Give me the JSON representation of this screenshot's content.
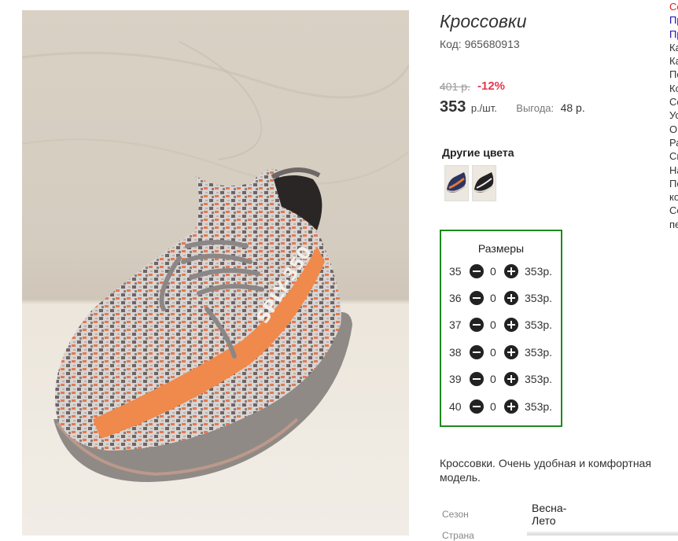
{
  "product": {
    "title": "Кроссовки",
    "sku": "Код: 965680913",
    "old_price": "401 р.",
    "discount": "-12%",
    "price": "353",
    "price_unit": "р./шт.",
    "saving_label": "Выгода:",
    "saving_value": "48 р."
  },
  "colors": {
    "title": "Другие цвета",
    "swatches": [
      "blue-orange-sneaker",
      "black-white-sneaker"
    ]
  },
  "sizes": {
    "title": "Размеры",
    "rows": [
      {
        "size": "35",
        "qty": "0",
        "price": "353р."
      },
      {
        "size": "36",
        "qty": "0",
        "price": "353р."
      },
      {
        "size": "37",
        "qty": "0",
        "price": "353р."
      },
      {
        "size": "38",
        "qty": "0",
        "price": "353р."
      },
      {
        "size": "39",
        "qty": "0",
        "price": "353р."
      },
      {
        "size": "40",
        "qty": "0",
        "price": "353р."
      }
    ]
  },
  "description": "Кроссовки. Очень удобная и комфортная модель.",
  "specs": [
    {
      "label": "Сезон",
      "value": "Весна-Лето"
    },
    {
      "label": "Страна",
      "value": ""
    }
  ],
  "side_column": [
    "Со",
    "Пр",
    "Пр",
    "Ка",
    "Ка",
    "По",
    "Ко",
    "Со",
    "Ус",
    "Оп",
    "Ра",
    "Св",
    "На",
    "По",
    "ко",
    "Со",
    "пе"
  ],
  "icons": {
    "minus": "minus-circle-icon",
    "plus": "plus-circle-icon"
  },
  "colors_theme": {
    "sizes_border": "#1e8a1e",
    "discount": "#e5384c",
    "link": "#1a0dab"
  }
}
